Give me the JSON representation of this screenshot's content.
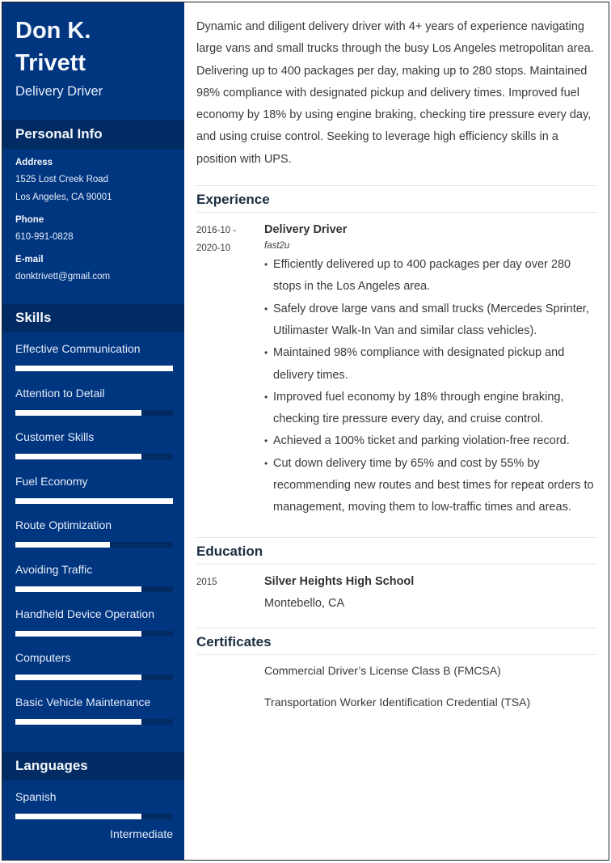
{
  "profile": {
    "name_line1": "Don K.",
    "name_line2": "Trivett",
    "title": "Delivery Driver"
  },
  "personal_info": {
    "heading": "Personal Info",
    "address_label": "Address",
    "address_line1": "1525 Lost Creek Road",
    "address_line2": "Los Angeles, CA 90001",
    "phone_label": "Phone",
    "phone": "610-991-0828",
    "email_label": "E-mail",
    "email": "donktrivett@gmail.com"
  },
  "skills": {
    "heading": "Skills",
    "items": [
      {
        "label": "Effective Communication",
        "level": 1.0
      },
      {
        "label": "Attention to Detail",
        "level": 0.8
      },
      {
        "label": "Customer Skills",
        "level": 0.8
      },
      {
        "label": "Fuel Economy",
        "level": 1.0
      },
      {
        "label": "Route Optimization",
        "level": 0.6
      },
      {
        "label": "Avoiding Traffic",
        "level": 0.8
      },
      {
        "label": "Handheld Device Operation",
        "level": 0.8
      },
      {
        "label": "Computers",
        "level": 0.8
      },
      {
        "label": "Basic Vehicle Maintenance",
        "level": 0.8
      }
    ]
  },
  "languages": {
    "heading": "Languages",
    "items": [
      {
        "label": "Spanish",
        "level": 0.8,
        "level_text": "Intermediate"
      }
    ]
  },
  "summary": "Dynamic and diligent delivery driver with 4+ years of experience navigating large vans and small trucks through the busy Los Angeles metropolitan area. Delivering up to 400 packages per day, making up to 280 stops. Maintained 98% compliance with designated pickup and delivery times. Improved fuel economy by 18% by using engine braking, checking tire pressure every day, and using cruise control. Seeking to leverage high efficiency skills in a position with UPS.",
  "experience": {
    "heading": "Experience",
    "jobs": [
      {
        "date_start": "2016-10 -",
        "date_end": "2020-10",
        "title": "Delivery Driver",
        "company": "fast2u",
        "bullets": [
          "Efficiently delivered up to 400 packages per day over 280 stops in the Los Angeles area.",
          "Safely drove large vans and small trucks (Mercedes Sprinter, Utilimaster Walk-In Van and similar class vehicles).",
          "Maintained 98% compliance with designated pickup and delivery times.",
          "Improved fuel economy by 18% through engine braking, checking tire pressure every day, and cruise control.",
          "Achieved a 100% ticket and parking violation-free record.",
          "Cut down delivery time by 65% and cost by 55% by recommending new routes and best times for repeat orders to management, moving them to low-traffic times and areas."
        ]
      }
    ]
  },
  "education": {
    "heading": "Education",
    "items": [
      {
        "date": "2015",
        "school": "Silver Heights High School",
        "location": "Montebello, CA"
      }
    ]
  },
  "certificates": {
    "heading": "Certificates",
    "items": [
      "Commercial Driver’s License Class B (FMCSA)",
      "Transportation Worker Identification Credential (TSA)"
    ]
  },
  "colors": {
    "sidebar_bg": "#003580",
    "sidebar_band": "#022b63",
    "heading_text": "#1c2e40",
    "body_text": "#3a3a3a"
  }
}
